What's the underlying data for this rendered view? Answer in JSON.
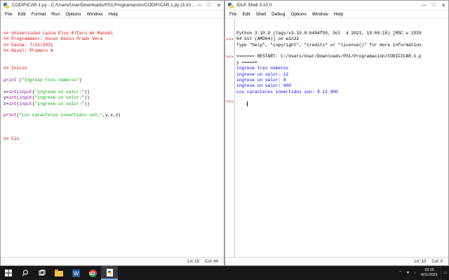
{
  "left_window": {
    "title": "CODIFICAR.1.py - C:/Users/User/Downloads/PS1/Programación/CODIFICAR.1.py (3.10....",
    "menu": [
      "File",
      "Edit",
      "Format",
      "Run",
      "Options",
      "Window",
      "Help"
    ],
    "code_lines": [
      [
        {
          "t": "## Universidad Laica Eloy Alfaro de Manabí",
          "c": "comment"
        }
      ],
      [
        {
          "t": "## Programador: Oscar Kevin Prado Vera",
          "c": "comment"
        }
      ],
      [
        {
          "t": "## Fecha: 7/11/2021",
          "c": "comment"
        }
      ],
      [
        {
          "t": "## Nivel: Primero A",
          "c": "comment"
        }
      ],
      [],
      [],
      [
        {
          "t": "## Inicio",
          "c": "comment"
        }
      ],
      [],
      [
        {
          "t": "print",
          "c": "builtin"
        },
        {
          "t": " (",
          "c": "default"
        },
        {
          "t": "\"Ingrese tres números\"",
          "c": "string"
        },
        {
          "t": ")",
          "c": "default"
        }
      ],
      [],
      [
        {
          "t": "x=",
          "c": "default"
        },
        {
          "t": "int",
          "c": "builtin"
        },
        {
          "t": "(",
          "c": "default"
        },
        {
          "t": "input",
          "c": "builtin"
        },
        {
          "t": "(",
          "c": "default"
        },
        {
          "t": "\"ingrese un valor:\"",
          "c": "string"
        },
        {
          "t": "))",
          "c": "default"
        }
      ],
      [
        {
          "t": "y=",
          "c": "default"
        },
        {
          "t": "int",
          "c": "builtin"
        },
        {
          "t": "(",
          "c": "default"
        },
        {
          "t": "input",
          "c": "builtin"
        },
        {
          "t": "(",
          "c": "default"
        },
        {
          "t": "\"ingrese un valor:\"",
          "c": "string"
        },
        {
          "t": "))",
          "c": "default"
        }
      ],
      [
        {
          "t": "z=",
          "c": "default"
        },
        {
          "t": "int",
          "c": "builtin"
        },
        {
          "t": "(",
          "c": "default"
        },
        {
          "t": "input",
          "c": "builtin"
        },
        {
          "t": "(",
          "c": "default"
        },
        {
          "t": "\"ingrese un valor:\"",
          "c": "string"
        },
        {
          "t": "))",
          "c": "default"
        }
      ],
      [],
      [
        {
          "t": "print",
          "c": "builtin"
        },
        {
          "t": "(",
          "c": "default"
        },
        {
          "t": "\"Los caracteres invertidos son:\"",
          "c": "string"
        },
        {
          "t": ",y,x,z)",
          "c": "default"
        }
      ],
      [],
      [],
      [],
      [
        {
          "t": "## Fin",
          "c": "comment"
        }
      ]
    ],
    "status": {
      "ln": "Ln: 15",
      "col": "Col: 44"
    }
  },
  "right_window": {
    "title": "IDLE Shell 3.10.0",
    "menu": [
      "File",
      "Edit",
      "Shell",
      "Debug",
      "Options",
      "Window",
      "Help"
    ],
    "shell_lines": [
      {
        "t": "Python 3.10.0 (tags/v3.10.0:b494f59, Oct  4 2021, 19:00:18) [MSC v.1929",
        "c": "default"
      },
      {
        "t": "64 bit (AMD64)] on win32",
        "c": "default"
      },
      {
        "t": "Type \"help\", \"copyright\", \"credits\" or \"license()\" for more information.",
        "c": "default"
      },
      {
        "t": "",
        "c": "default"
      },
      {
        "t": "======= RESTART: C:/Users/User/Downloads/PS1/Programación/CODIFICAR.1.p",
        "c": "restart"
      },
      {
        "t": "y ======",
        "c": "restart"
      },
      {
        "t": "Ingrese tres números",
        "c": "out"
      },
      {
        "t": "ingrese un valor: 12",
        "c": "out"
      },
      {
        "t": "ingrese un valor: 8",
        "c": "out"
      },
      {
        "t": "ingrese un valor: 900",
        "c": "out"
      },
      {
        "t": "Los caracteres invertidos son: 8 12 900",
        "c": "out"
      }
    ],
    "prompts": [
      ">>>",
      ">>>",
      ">>>"
    ],
    "status": {
      "ln": "Ln: 10",
      "col": "Col: 0"
    }
  },
  "taskbar": {
    "time": "23:15",
    "date": "9/11/2021",
    "icons": [
      "windows-start-icon",
      "search-icon",
      "task-view-icon",
      "file-explorer-icon",
      "word-icon",
      "chrome-icon",
      "python-idle-icon"
    ]
  },
  "colors": {
    "comment": "#dd0000",
    "string": "#00aa00",
    "builtin": "#900090",
    "shell_output": "#0000ff",
    "taskbar": "#17171a"
  }
}
